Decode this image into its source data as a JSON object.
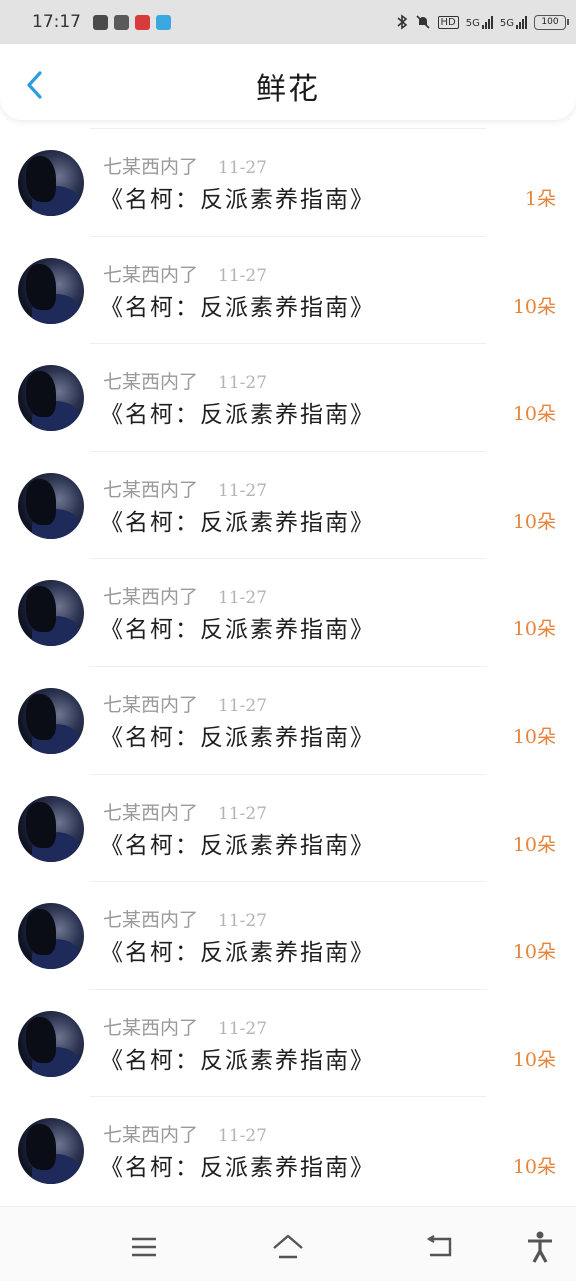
{
  "status_bar": {
    "time": "17:17",
    "network_hd": "HD",
    "network_5g_a": "5G",
    "network_5g_b": "5G",
    "battery": "100"
  },
  "header": {
    "title": "鲜花"
  },
  "list": [
    {
      "author": "七某西内了",
      "date": "11-27",
      "title": "《名柯：反派素养指南》",
      "count": "1朵"
    },
    {
      "author": "七某西内了",
      "date": "11-27",
      "title": "《名柯：反派素养指南》",
      "count": "10朵"
    },
    {
      "author": "七某西内了",
      "date": "11-27",
      "title": "《名柯：反派素养指南》",
      "count": "10朵"
    },
    {
      "author": "七某西内了",
      "date": "11-27",
      "title": "《名柯：反派素养指南》",
      "count": "10朵"
    },
    {
      "author": "七某西内了",
      "date": "11-27",
      "title": "《名柯：反派素养指南》",
      "count": "10朵"
    },
    {
      "author": "七某西内了",
      "date": "11-27",
      "title": "《名柯：反派素养指南》",
      "count": "10朵"
    },
    {
      "author": "七某西内了",
      "date": "11-27",
      "title": "《名柯：反派素养指南》",
      "count": "10朵"
    },
    {
      "author": "七某西内了",
      "date": "11-27",
      "title": "《名柯：反派素养指南》",
      "count": "10朵"
    },
    {
      "author": "七某西内了",
      "date": "11-27",
      "title": "《名柯：反派素养指南》",
      "count": "10朵"
    },
    {
      "author": "七某西内了",
      "date": "11-27",
      "title": "《名柯：反派素养指南》",
      "count": "10朵"
    }
  ],
  "bottom_nav": {
    "icons": [
      "menu-icon",
      "home-icon",
      "back-icon",
      "accessibility-icon"
    ]
  },
  "colors": {
    "accent_blue": "#2d9be0",
    "count_orange": "#e8833a",
    "author_gray": "#9a9a9a"
  }
}
